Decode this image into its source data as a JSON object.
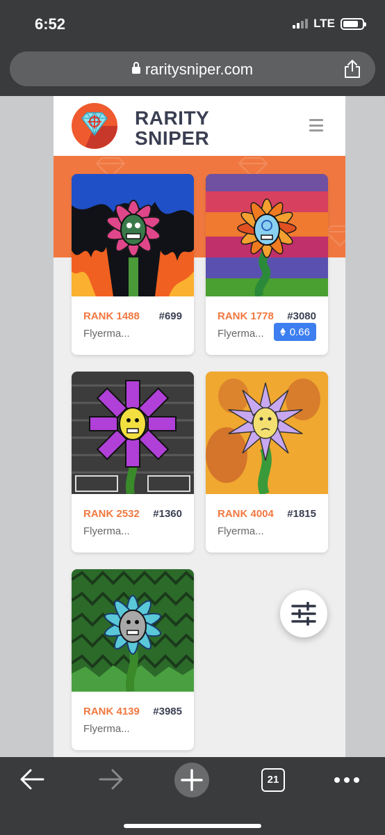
{
  "status_bar": {
    "time": "6:52",
    "network": "LTE",
    "battery_level": 0.8
  },
  "browser": {
    "url": "raritysniper.com",
    "icons": {
      "lock": "lock-icon",
      "share": "share-icon"
    },
    "toolbar": {
      "back": "back-arrow-icon",
      "forward": "forward-arrow-icon",
      "new_tab": "plus-icon",
      "tabs_count": "21",
      "more": "more-dots-icon"
    }
  },
  "site": {
    "logo_line1": "RARITY",
    "logo_line2": "SNIPER",
    "menu_icon": "hamburger-menu-icon",
    "colors": {
      "accent": "#f07840",
      "dark_text": "#3b3f52",
      "price_badge": "#3d7ef0",
      "background": "#eeeeee"
    }
  },
  "cards": [
    {
      "rank": "RANK 1488",
      "id": "#699",
      "name": "Flyerma..."
    },
    {
      "rank": "RANK 1778",
      "id": "#3080",
      "name": "Flyerma...",
      "price": "0.66",
      "price_icon": "eth-icon"
    },
    {
      "rank": "RANK 2532",
      "id": "#1360",
      "name": "Flyerma..."
    },
    {
      "rank": "RANK 4004",
      "id": "#1815",
      "name": "Flyerma..."
    },
    {
      "rank": "RANK 4139",
      "id": "#3985",
      "name": "Flyerma..."
    }
  ],
  "filter_button": {
    "icon": "sliders-filter-icon"
  }
}
